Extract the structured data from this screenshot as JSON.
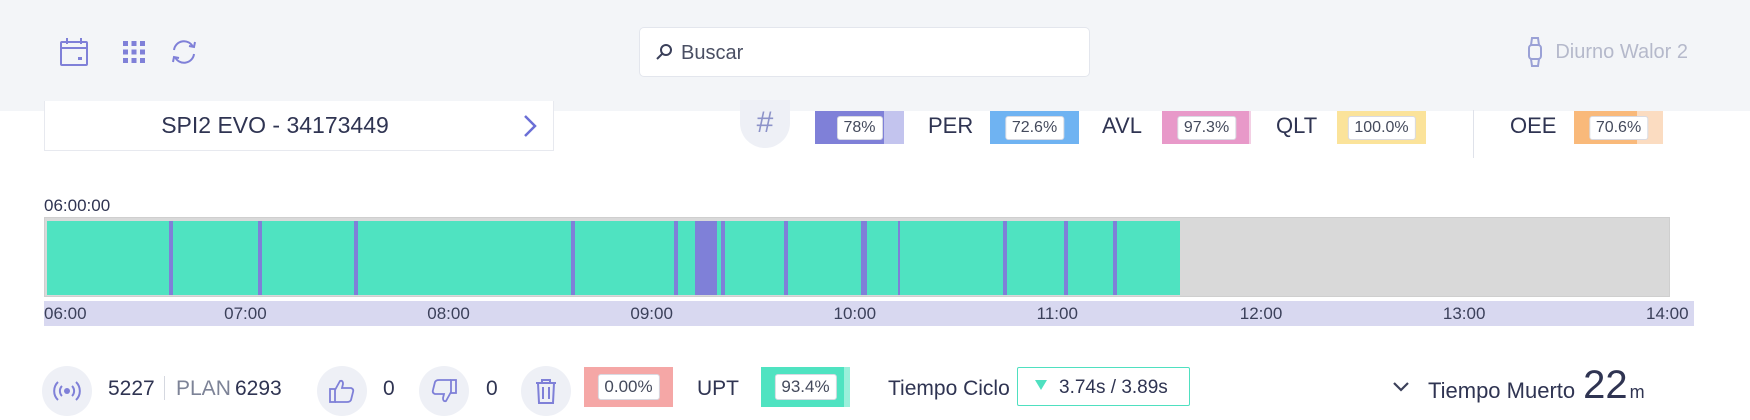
{
  "topbar": {
    "icons": [
      "calendar-icon",
      "grid-icon",
      "refresh-icon"
    ],
    "search_placeholder": "Buscar",
    "user_label": "Diurno Walor 2"
  },
  "machine": {
    "name": "SPI2 EVO - 34173449"
  },
  "kpis": [
    {
      "label": "",
      "value": "78%",
      "fraction": 0.78,
      "color": "#7f80d8",
      "rest_color": "#c3c4ee"
    },
    {
      "label": "PER",
      "value": "72.6%",
      "fraction": 0.726,
      "color": "#6fb3f2",
      "rest_color": "#6fb3f2"
    },
    {
      "label": "AVL",
      "value": "97.3%",
      "fraction": 0.973,
      "color": "#e899c9",
      "rest_color": "#f3cfe4"
    },
    {
      "label": "QLT",
      "value": "100.0%",
      "fraction": 1.0,
      "color": "#fbe39a",
      "rest_color": "#fbe39a"
    },
    {
      "label": "OEE",
      "value": "70.6%",
      "fraction": 0.706,
      "color": "#f9b97a",
      "rest_color": "#fbdcc1"
    }
  ],
  "timeline": {
    "start_label": "06:00:00",
    "ticks": [
      "06:00",
      "07:00",
      "08:00",
      "09:00",
      "10:00",
      "11:00",
      "12:00",
      "13:00",
      "14:00"
    ],
    "range_hours": [
      6,
      14
    ],
    "running_color": "#4fe3c1",
    "stop_color": "#7f80d8",
    "segments": [
      {
        "start": 6.0,
        "end": 6.6,
        "state": "run"
      },
      {
        "start": 6.6,
        "end": 6.62,
        "state": "stop"
      },
      {
        "start": 6.62,
        "end": 7.04,
        "state": "run"
      },
      {
        "start": 7.04,
        "end": 7.06,
        "state": "stop"
      },
      {
        "start": 7.06,
        "end": 7.51,
        "state": "run"
      },
      {
        "start": 7.51,
        "end": 7.53,
        "state": "stop"
      },
      {
        "start": 7.53,
        "end": 8.58,
        "state": "run"
      },
      {
        "start": 8.58,
        "end": 8.6,
        "state": "stop"
      },
      {
        "start": 8.6,
        "end": 9.09,
        "state": "run"
      },
      {
        "start": 9.09,
        "end": 9.11,
        "state": "stop"
      },
      {
        "start": 9.11,
        "end": 9.19,
        "state": "run"
      },
      {
        "start": 9.19,
        "end": 9.3,
        "state": "stop"
      },
      {
        "start": 9.3,
        "end": 9.32,
        "state": "run"
      },
      {
        "start": 9.32,
        "end": 9.34,
        "state": "stop"
      },
      {
        "start": 9.34,
        "end": 9.63,
        "state": "run"
      },
      {
        "start": 9.63,
        "end": 9.65,
        "state": "stop"
      },
      {
        "start": 9.65,
        "end": 10.01,
        "state": "run"
      },
      {
        "start": 10.01,
        "end": 10.04,
        "state": "stop"
      },
      {
        "start": 10.04,
        "end": 10.19,
        "state": "run"
      },
      {
        "start": 10.19,
        "end": 10.2,
        "state": "stop"
      },
      {
        "start": 10.2,
        "end": 10.71,
        "state": "run"
      },
      {
        "start": 10.71,
        "end": 10.73,
        "state": "stop"
      },
      {
        "start": 10.73,
        "end": 11.01,
        "state": "run"
      },
      {
        "start": 11.01,
        "end": 11.03,
        "state": "stop"
      },
      {
        "start": 11.03,
        "end": 11.25,
        "state": "run"
      },
      {
        "start": 11.25,
        "end": 11.27,
        "state": "stop"
      },
      {
        "start": 11.27,
        "end": 11.58,
        "state": "run"
      }
    ]
  },
  "stats": {
    "produced": "5227",
    "plan_label": "PLAN",
    "plan_value": "6293",
    "good": "0",
    "bad": "0",
    "scrap_pct": "0.00%",
    "scrap_color": "#f5a7a6",
    "upt_label": "UPT",
    "upt_value": "93.4%",
    "upt_fraction": 0.934,
    "upt_color": "#4fe3c1",
    "upt_rest_color": "#9af0db",
    "cycle_label": "Tiempo Ciclo",
    "cycle_value": "3.74s  /  3.89s",
    "dead_label": "Tiempo Muerto",
    "dead_value": "22",
    "dead_unit": "m"
  }
}
